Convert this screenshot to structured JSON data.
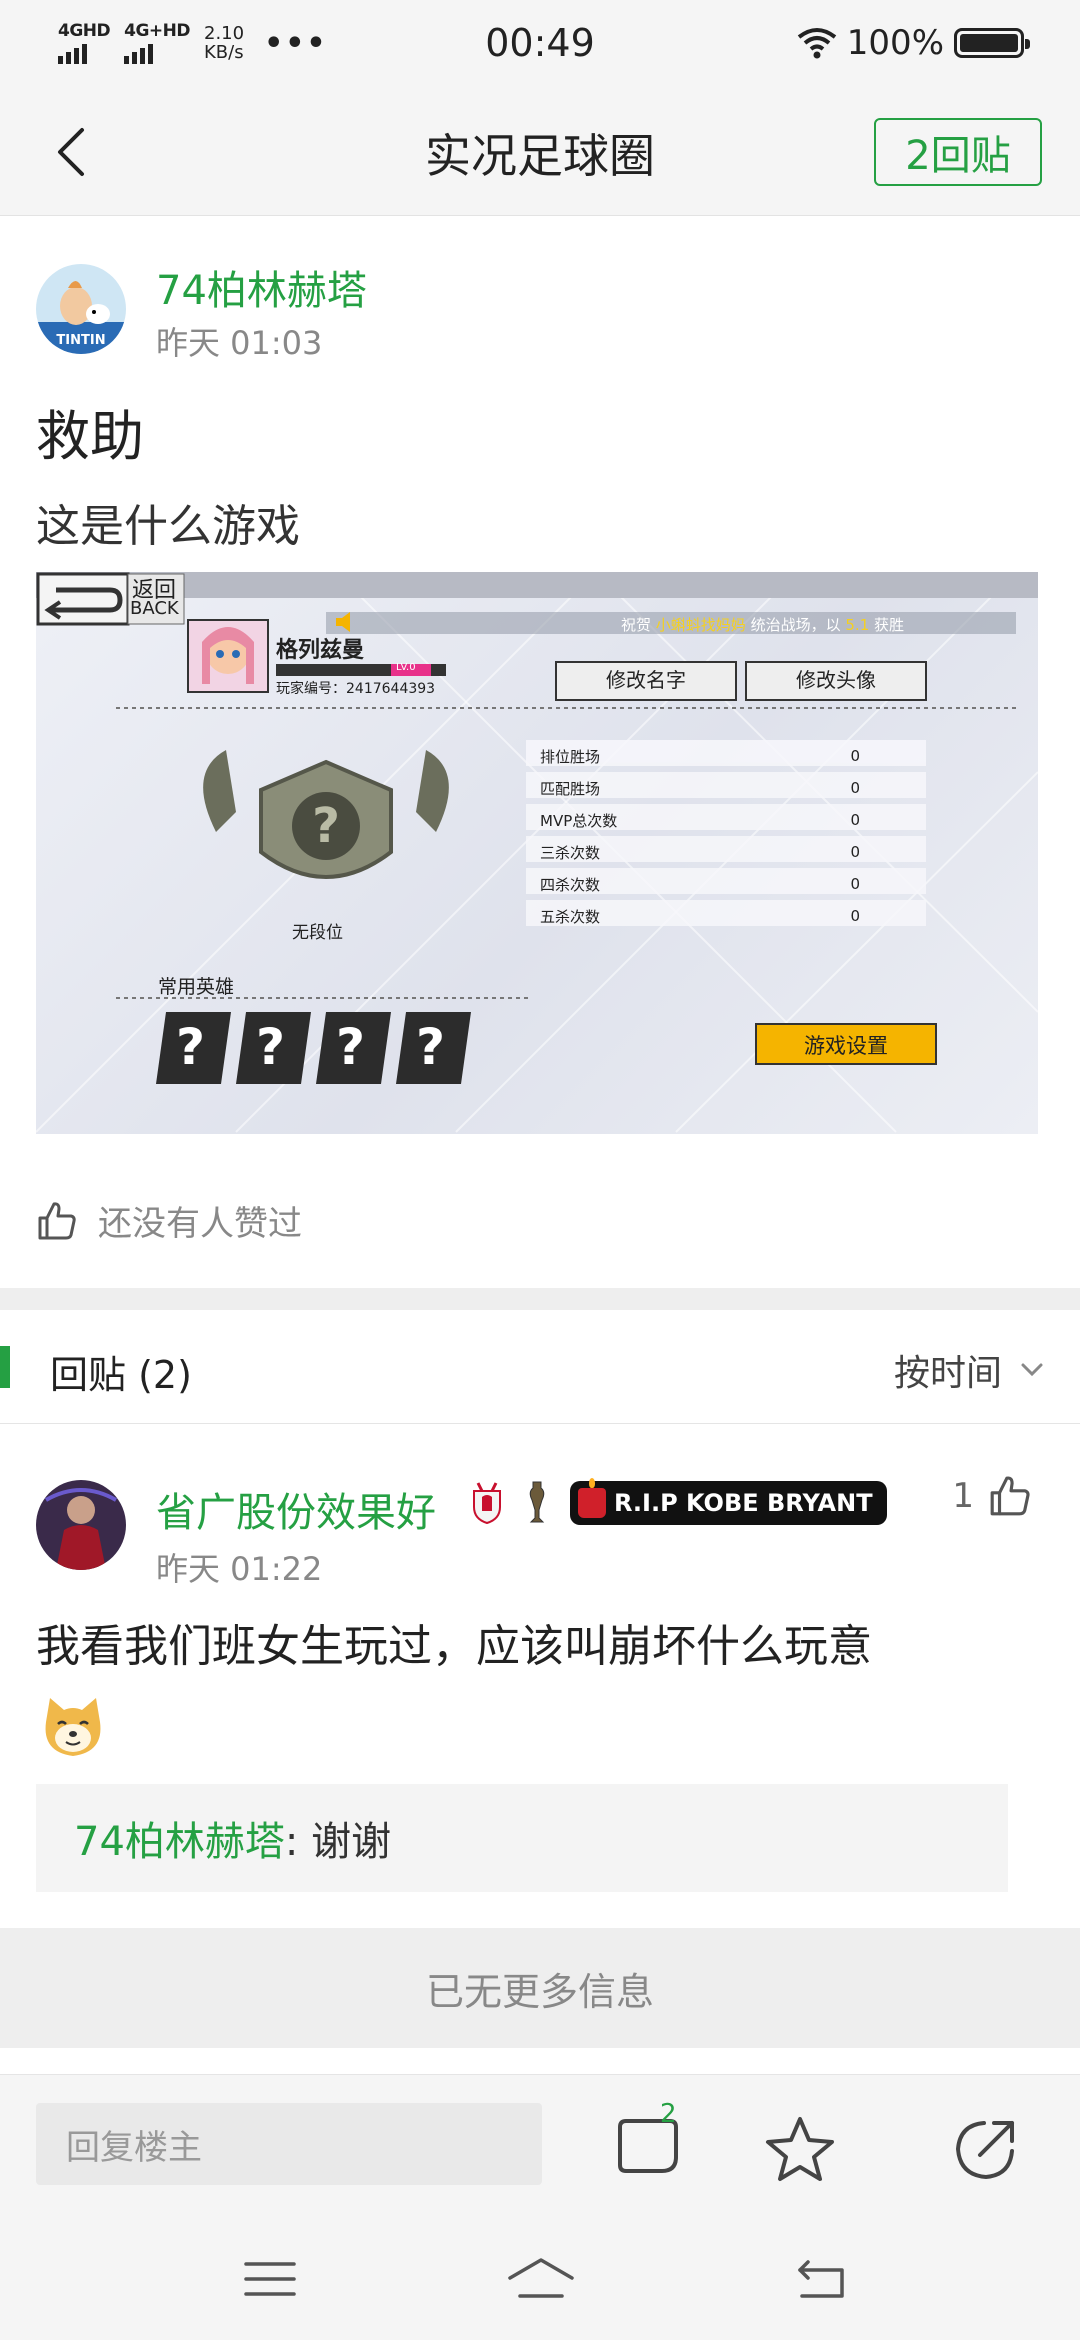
{
  "status_bar": {
    "net1": "4GHD",
    "net2": "4G+HD",
    "speed_value": "2.10",
    "speed_unit": "KB/s",
    "more": "•••",
    "time": "00:49",
    "battery": "100%"
  },
  "header": {
    "title": "实况足球圈",
    "reply_button": "2回贴"
  },
  "post": {
    "author": "74柏林赫塔",
    "time": "昨天 01:03",
    "title": "救助",
    "body": "这是什么游戏",
    "likes_text": "还没有人赞过",
    "screenshot": {
      "back_cn": "返回",
      "back_en": "BACK",
      "marquee_prefix": "祝贺",
      "marquee_name": "小蝌蚪找妈妈",
      "marquee_suffix": "统治战场，以",
      "marquee_num": "5.1",
      "marquee_end": "获胜",
      "player_name": "格列兹曼",
      "level": "LV.0",
      "player_id": "玩家编号：2417644393",
      "rename_btn": "修改名字",
      "avatar_btn": "修改头像",
      "rank_label": "无段位",
      "heroes_label": "常用英雄",
      "stats": [
        {
          "label": "排位胜场",
          "value": "0"
        },
        {
          "label": "匹配胜场",
          "value": "0"
        },
        {
          "label": "MVP总次数",
          "value": "0"
        },
        {
          "label": "三杀次数",
          "value": "0"
        },
        {
          "label": "四杀次数",
          "value": "0"
        },
        {
          "label": "五杀次数",
          "value": "0"
        }
      ],
      "hero_slot": "?",
      "settings_btn": "游戏设置"
    }
  },
  "replies": {
    "title": "回贴 (2)",
    "sort": "按时间"
  },
  "reply": {
    "author": "省广股份效果好",
    "time": "昨天 01:22",
    "badge_text": "R.I.P KOBE BRYANT",
    "like_count": "1",
    "text": "我看我们班女生玩过，应该叫崩坏什么玩意",
    "quote_name": "74柏林赫塔",
    "quote_text": ": 谢谢"
  },
  "no_more": "已无更多信息",
  "reply_bar": {
    "placeholder": "回复楼主",
    "comment_count": "2"
  }
}
